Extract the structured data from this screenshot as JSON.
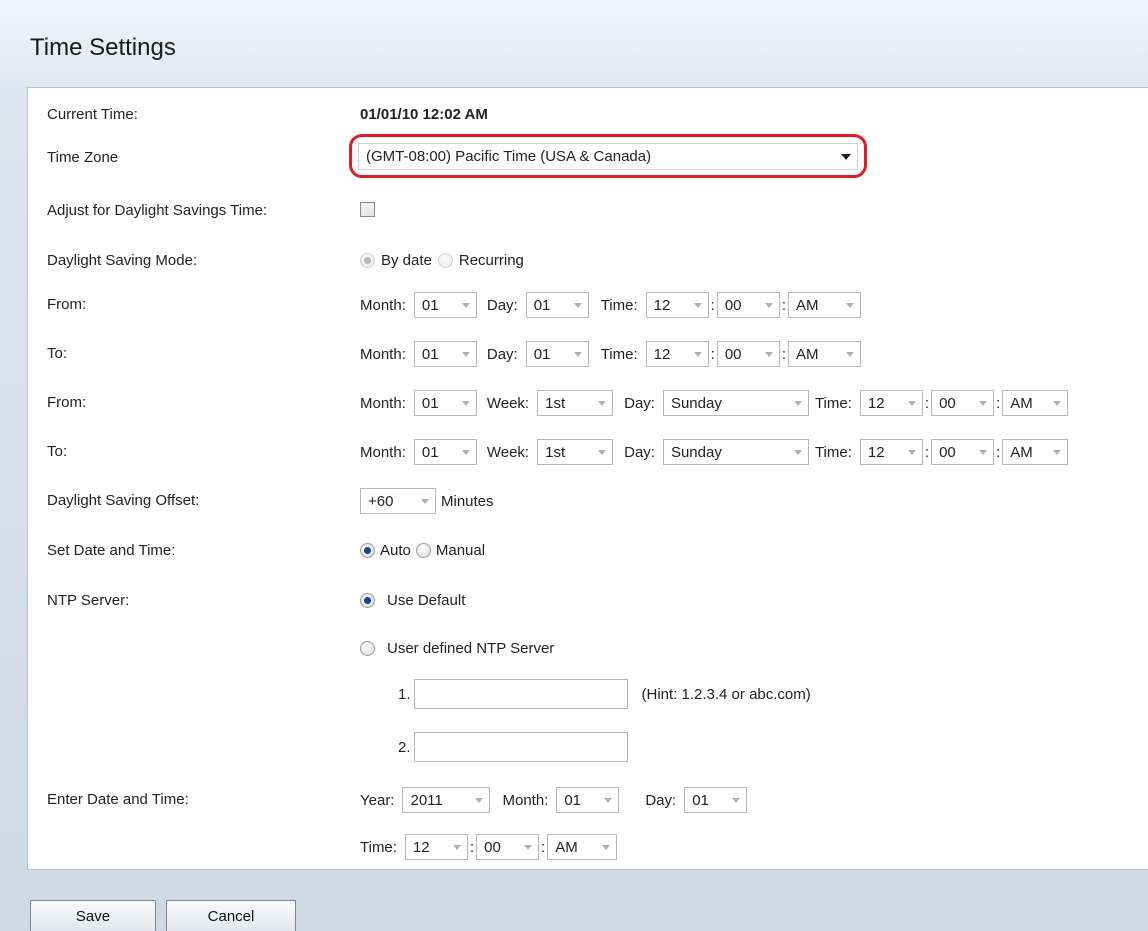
{
  "page": {
    "title": "Time Settings"
  },
  "current_time": {
    "label": "Current Time:",
    "value": "01/01/10 12:02 AM"
  },
  "time_zone": {
    "label": "Time Zone",
    "value": "(GMT-08:00) Pacific Time (USA & Canada)"
  },
  "dst_adjust": {
    "label": "Adjust for Daylight Savings Time:",
    "checked": false
  },
  "dst_mode": {
    "label": "Daylight Saving Mode:",
    "option_by_date": "By date",
    "option_recurring": "Recurring",
    "selected": "By date"
  },
  "by_date_from": {
    "label": "From:",
    "month_label": "Month:",
    "month": "01",
    "day_label": "Day:",
    "day": "01",
    "time_label": "Time:",
    "hour": "12",
    "colon": ":",
    "minute": "00",
    "ampm": "AM"
  },
  "by_date_to": {
    "label": "To:",
    "month_label": "Month:",
    "month": "01",
    "day_label": "Day:",
    "day": "01",
    "time_label": "Time:",
    "hour": "12",
    "colon": ":",
    "minute": "00",
    "ampm": "AM"
  },
  "recurring_from": {
    "label": "From:",
    "month_label": "Month:",
    "month": "01",
    "week_label": "Week:",
    "week": "1st",
    "day_label": "Day:",
    "day": "Sunday",
    "time_label": "Time:",
    "hour": "12",
    "colon": ":",
    "minute": "00",
    "ampm": "AM"
  },
  "recurring_to": {
    "label": "To:",
    "month_label": "Month:",
    "month": "01",
    "week_label": "Week:",
    "week": "1st",
    "day_label": "Day:",
    "day": "Sunday",
    "time_label": "Time:",
    "hour": "12",
    "colon": ":",
    "minute": "00",
    "ampm": "AM"
  },
  "dst_offset": {
    "label": "Daylight Saving Offset:",
    "value": "+60",
    "unit": "Minutes"
  },
  "set_date_time": {
    "label": "Set Date and Time:",
    "option_auto": "Auto",
    "option_manual": "Manual",
    "selected": "Auto"
  },
  "ntp": {
    "label": "NTP Server:",
    "option_default": "Use Default",
    "option_user": "User defined NTP Server",
    "server1_label": "1.",
    "server1_value": "",
    "server2_label": "2.",
    "server2_value": "",
    "hint": "(Hint: 1.2.3.4 or abc.com)"
  },
  "manual_date": {
    "label": "Enter Date and Time:",
    "year_label": "Year:",
    "year": "2011",
    "month_label": "Month:",
    "month": "01",
    "day_label": "Day:",
    "day": "01",
    "time_label": "Time:",
    "hour": "12",
    "colon": ":",
    "minute": "00",
    "ampm": "AM"
  },
  "buttons": {
    "save": "Save",
    "cancel": "Cancel"
  }
}
